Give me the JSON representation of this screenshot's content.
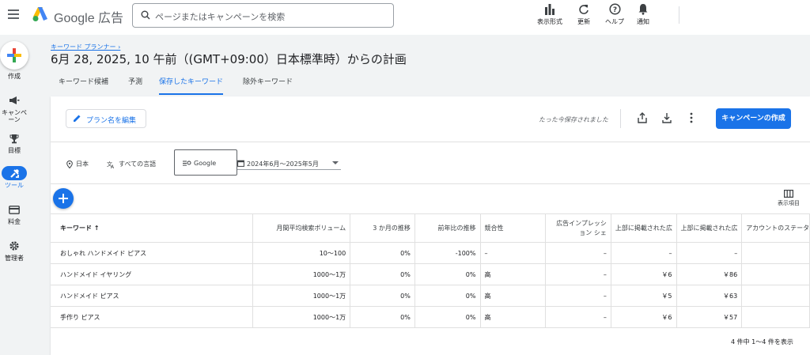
{
  "app": {
    "title": "Google 広告",
    "search_placeholder": "ページまたはキャンペーンを検索",
    "toolbar": [
      {
        "icon": "chart-icon",
        "label": "表示形式"
      },
      {
        "icon": "refresh-icon",
        "label": "更新"
      },
      {
        "icon": "help-icon",
        "label": "ヘルプ"
      },
      {
        "icon": "bell-icon",
        "label": "通知"
      }
    ]
  },
  "nav": {
    "create_label": "作成",
    "items": [
      {
        "icon": "megaphone-icon",
        "label": "キャンペーン"
      },
      {
        "icon": "trophy-icon",
        "label": "目標"
      },
      {
        "icon": "tools-icon",
        "label": "ツール"
      },
      {
        "icon": "billing-icon",
        "label": "料金"
      },
      {
        "icon": "gear-icon",
        "label": "管理者"
      }
    ]
  },
  "header": {
    "breadcrumb": "キーワード プランナー ›",
    "title": "6月 28, 2025, 10 午前（(GMT+09:00）日本標準時）からの計画",
    "tabs": [
      "キーワード候補",
      "予測",
      "保存したキーワード",
      "除外キーワード"
    ],
    "active_tab": "保存したキーワード"
  },
  "card": {
    "rename_label": "プラン名を編集",
    "saved_text": "たった今保存されました",
    "create_campaign_label": "キャンペーンの作成",
    "filters": {
      "location": "日本",
      "language": "すべての言語",
      "network": "Google",
      "date_range": "2024年6月～2025年5月"
    },
    "columns_label": "表示項目"
  },
  "table": {
    "headers": [
      "キーワード ↑",
      "月間平均検索ボリューム",
      "3 か月の推移",
      "前年比の推移",
      "競合性",
      "広告インプレッション シェ",
      "上部に掲載された広",
      "上部に掲載された広",
      "アカウントのステータス"
    ],
    "rows": [
      [
        "おしゃれ ハンドメイド ピアス",
        "10～100",
        "0%",
        "-100%",
        "–",
        "–",
        "–",
        "–",
        ""
      ],
      [
        "ハンドメイド イヤリング",
        "1000～1万",
        "0%",
        "0%",
        "高",
        "–",
        "￥6",
        "￥86",
        ""
      ],
      [
        "ハンドメイド ピアス",
        "1000～1万",
        "0%",
        "0%",
        "高",
        "–",
        "￥5",
        "￥63",
        ""
      ],
      [
        "手作り ピアス",
        "1000～1万",
        "0%",
        "0%",
        "高",
        "–",
        "￥6",
        "￥57",
        ""
      ]
    ],
    "pagination": "4 件中 1～4 件を表示"
  }
}
